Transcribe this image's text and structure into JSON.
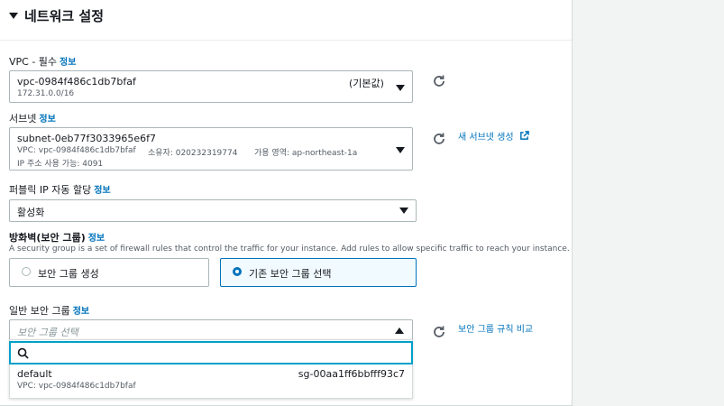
{
  "section": {
    "title": "네트워크 설정"
  },
  "vpc": {
    "label": "VPC - 필수",
    "info": "정보",
    "value": "vpc-0984f486c1db7bfaf",
    "cidr": "172.31.0.0/16",
    "default_badge": "(기본값)"
  },
  "subnet": {
    "label": "서브넷",
    "info": "정보",
    "value": "subnet-0eb77f3033965e6f7",
    "vpc_line": "VPC: vpc-0984f486c1db7bfaf",
    "owner_line": "소유자: 020232319774",
    "az_line": "가용 영역: ap-northeast-1a",
    "ip_line": "IP 주소 사용 가능: 4091",
    "new_link": "새 서브넷 생성"
  },
  "public_ip": {
    "label": "퍼블릭 IP 자동 할당",
    "info": "정보",
    "value": "활성화"
  },
  "firewall": {
    "label": "방화벽(보안 그룹)",
    "info": "정보",
    "description": "A security group is a set of firewall rules that control the traffic for your instance. Add rules to allow specific traffic to reach your instance.",
    "options": [
      {
        "label": "보안 그룹 생성",
        "selected": false
      },
      {
        "label": "기존 보안 그룹 선택",
        "selected": true
      }
    ]
  },
  "common_sg": {
    "label": "일반 보안 그룹",
    "info": "정보",
    "placeholder": "보안 그룹 선택",
    "compare_link": "보안 그룹 규칙 비교",
    "search_value": "",
    "results": [
      {
        "name": "default",
        "id": "sg-00aa1ff6bbfff93c7",
        "vpc": "VPC: vpc-0984f486c1db7bfaf"
      }
    ]
  },
  "colors": {
    "link": "#0073bb",
    "focus": "#00a1c9",
    "border": "#aab7b8",
    "selected_bg": "#f1faff"
  },
  "icons": [
    "caret-down-icon",
    "refresh-icon",
    "external-link-icon",
    "search-icon"
  ]
}
